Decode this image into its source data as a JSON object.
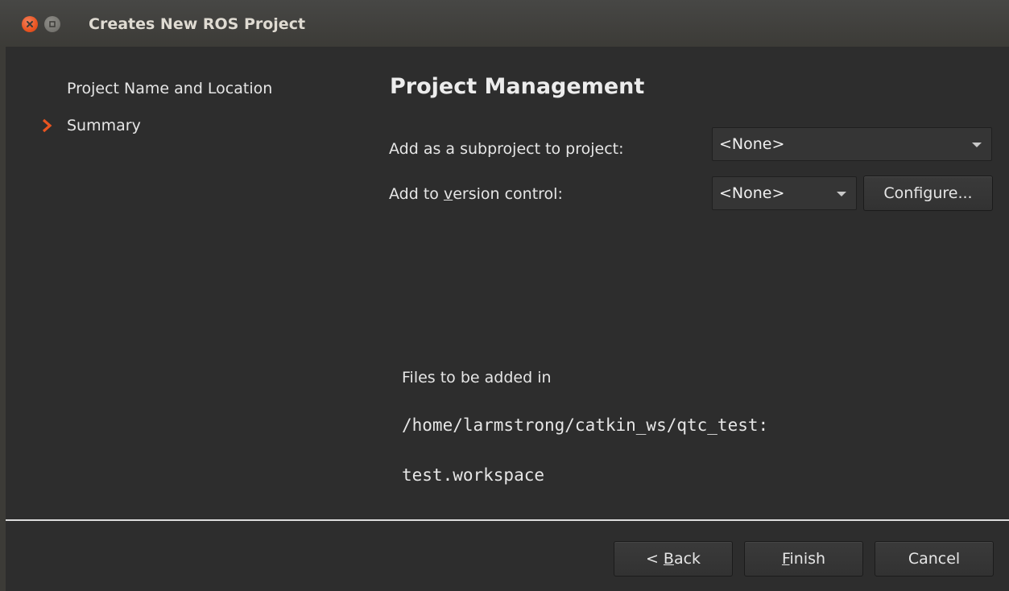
{
  "window": {
    "title": "Creates New ROS Project"
  },
  "nav": {
    "items": [
      {
        "label": "Project Name and Location",
        "current": false
      },
      {
        "label": "Summary",
        "current": true
      }
    ]
  },
  "page": {
    "heading": "Project Management",
    "subproject_label": "Add as a subproject to project:",
    "subproject_value": "<None>",
    "vcs_label_pre": "Add to ",
    "vcs_label_mnemonic": "v",
    "vcs_label_post": "ersion control:",
    "vcs_value": "<None>",
    "configure_label": "Configure...",
    "files_label": "Files to be added in",
    "files_path": "/home/larmstrong/catkin_ws/qtc_test:",
    "files_list": [
      "test.workspace"
    ]
  },
  "buttons": {
    "back_pre": "< ",
    "back_mnemonic": "B",
    "back_post": "ack",
    "finish_mnemonic": "F",
    "finish_post": "inish",
    "cancel": "Cancel"
  },
  "colors": {
    "accent": "#e95420",
    "background": "#2d2d2d",
    "titlebar": "#3c3b37"
  }
}
